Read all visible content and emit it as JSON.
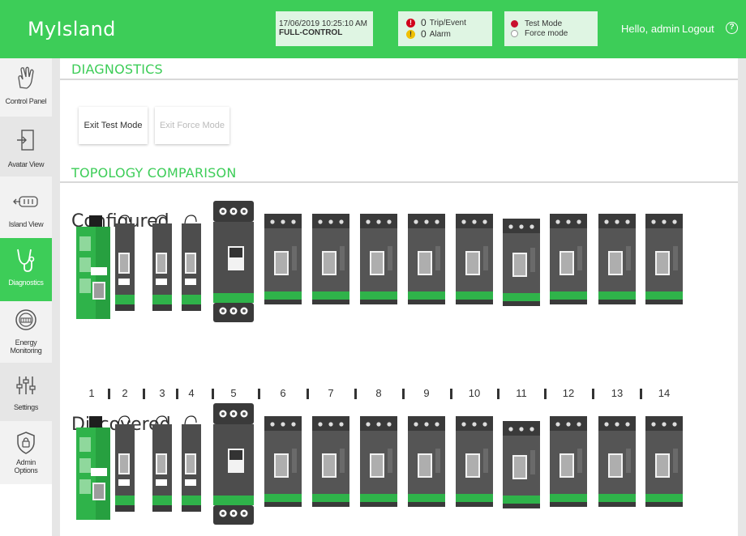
{
  "app": {
    "title": "MyIsland"
  },
  "status": {
    "datetime": "17/06/2019 10:25:10 AM",
    "control": "FULL-CONTROL",
    "trip_count": "0",
    "trip_label": "Trip/Event",
    "alarm_count": "0",
    "alarm_label": "Alarm",
    "test_mode": "Test Mode",
    "force_mode": "Force mode"
  },
  "header": {
    "greeting": "Hello, admin",
    "logout": "Logout",
    "help_icon": "?"
  },
  "sidebar": {
    "items": [
      {
        "label": "Control Panel",
        "icon": "hand-pointer-icon"
      },
      {
        "label": "Avatar View",
        "icon": "enter-door-icon"
      },
      {
        "label": "Island View",
        "icon": "island-modules-icon"
      },
      {
        "label": "Diagnostics",
        "icon": "stethoscope-icon"
      },
      {
        "label": "Energy Monitoring",
        "icon": "energy-meter-icon"
      },
      {
        "label": "Settings",
        "icon": "sliders-icon"
      },
      {
        "label": "Admin Options",
        "icon": "shield-lock-icon"
      }
    ],
    "active": "Diagnostics"
  },
  "main": {
    "diagnostics_title": "DIAGNOSTICS",
    "exit_test_mode": "Exit Test Mode",
    "exit_force_mode": "Exit Force Mode",
    "topology_title": "TOPOLOGY COMPARISON",
    "configured_label": "Configured",
    "discovered_label": "Discovered",
    "slots": [
      "1",
      "2",
      "3",
      "4",
      "5",
      "6",
      "7",
      "8",
      "9",
      "10",
      "11",
      "12",
      "13",
      "14"
    ]
  },
  "colors": {
    "brand_green": "#3dcd58",
    "ok_green": "#3dcd58",
    "module_dark": "#4a4a4a",
    "module_base_green": "#2fb34a"
  }
}
